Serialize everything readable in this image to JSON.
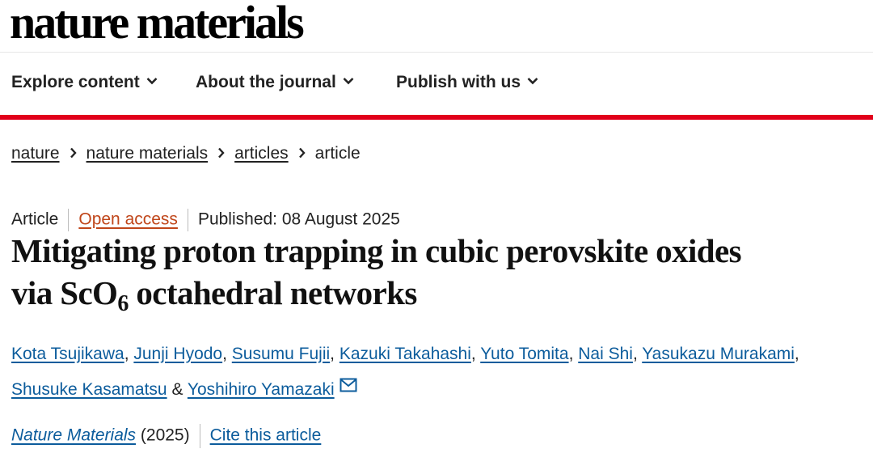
{
  "site": {
    "logo_text": "nature materials"
  },
  "nav": {
    "items": [
      {
        "label": "Explore content"
      },
      {
        "label": "About the journal"
      },
      {
        "label": "Publish with us"
      }
    ]
  },
  "breadcrumb": {
    "items": [
      {
        "label": "nature"
      },
      {
        "label": "nature materials"
      },
      {
        "label": "articles"
      },
      {
        "label": "article"
      }
    ]
  },
  "article": {
    "type": "Article",
    "access": "Open access",
    "published": "Published: 08 August 2025",
    "title_line1": "Mitigating proton trapping in cubic perovskite oxides",
    "title_line2_prefix": "via ScO",
    "title_line2_sub": "6",
    "title_line2_suffix": " octahedral networks",
    "authors": [
      "Kota Tsujikawa",
      "Junji Hyodo",
      "Susumu Fujii",
      "Kazuki Takahashi",
      "Yuto Tomita",
      "Nai Shi",
      "Yasukazu Murakami",
      "Shusuke Kasamatsu",
      "Yoshihiro Yamazaki"
    ],
    "author_separators": {
      "comma": ", ",
      "ampersand": " & "
    },
    "journal": "Nature Materials",
    "year": "(2025)",
    "cite_label": "Cite this article"
  },
  "icons": {
    "nav_dropdown": "chevron-down-icon",
    "breadcrumb_separator": "chevron-right-icon",
    "corresponding_author": "mail-icon"
  },
  "colors": {
    "accent_red": "#e1001a",
    "link_blue": "#0c5c9c",
    "open_access": "#c0461a"
  }
}
